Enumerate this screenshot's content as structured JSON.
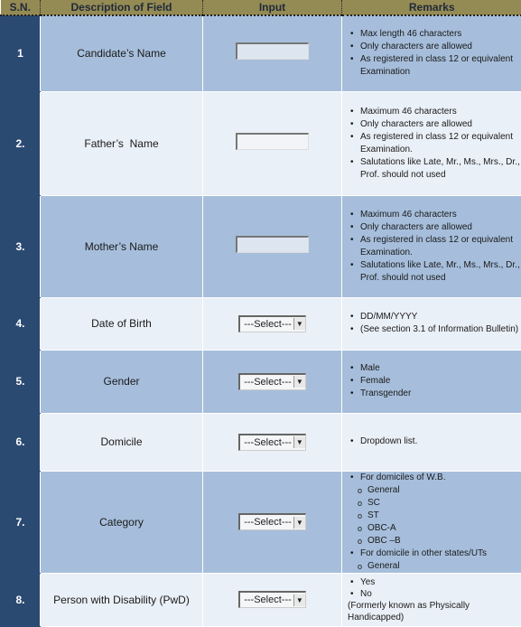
{
  "header": {
    "sn": "S.N.",
    "description": "Description of Field",
    "input": "Input",
    "remarks": "Remarks"
  },
  "colors": {
    "header_bg": "#948a54",
    "sn_bg": "#2b4a72",
    "row_dark": "#a6bedb",
    "row_light": "#eaf0f7"
  },
  "rows": [
    {
      "sn": "1",
      "field": "Candidate’s Name",
      "input_type": "textbox",
      "remarks": [
        "Max length 46 characters",
        "Only characters are allowed",
        "As registered in class 12 or equivalent Examination"
      ]
    },
    {
      "sn": "2.",
      "field": "Father’s  Name",
      "input_type": "textbox",
      "remarks": [
        "Maximum 46 characters",
        "Only characters are allowed",
        "As registered in class 12 or equivalent Examination.",
        "Salutations like Late, Mr., Ms., Mrs., Dr., Prof. should not used"
      ]
    },
    {
      "sn": "3.",
      "field": "Mother’s Name",
      "input_type": "textbox",
      "remarks": [
        "Maximum 46 characters",
        "Only characters are allowed",
        "As registered in class 12 or equivalent Examination.",
        "Salutations like Late, Mr., Ms., Mrs., Dr., Prof. should not used"
      ]
    },
    {
      "sn": "4.",
      "field": "Date of Birth",
      "input_type": "select",
      "select_value": "---Select---",
      "remarks": [
        "DD/MM/YYYY",
        "(See section 3.1 of Information Bulletin)"
      ]
    },
    {
      "sn": "5.",
      "field": "Gender",
      "input_type": "select",
      "select_value": "---Select---",
      "remarks": [
        "Male",
        "Female",
        "Transgender"
      ]
    },
    {
      "sn": "6.",
      "field": "Domicile",
      "input_type": "select",
      "select_value": "---Select---",
      "remarks": [
        "Dropdown list."
      ]
    },
    {
      "sn": "7.",
      "field": "Category",
      "input_type": "select",
      "select_value": "---Select---",
      "remarks": [
        "For domiciles of W.B.",
        "General",
        "SC",
        "ST",
        "OBC-A",
        "OBC –B",
        "For domicile in other states/UTs",
        "General"
      ]
    },
    {
      "sn": "8.",
      "field": "Person with Disability (PwD)",
      "input_type": "select",
      "select_value": "---Select---",
      "remarks": [
        "Yes",
        "No",
        "(Formerly known as Physically Handicapped)"
      ]
    }
  ]
}
